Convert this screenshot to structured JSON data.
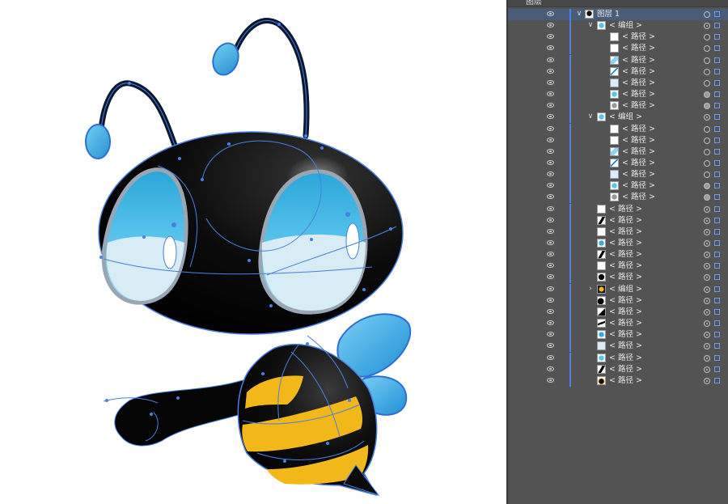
{
  "panel": {
    "tab_label": "图层",
    "rows": [
      {
        "label": "图层 1",
        "level": 0,
        "chev": "open",
        "thumb": "figure",
        "target": "ring"
      },
      {
        "label": "< 编组 >",
        "level": 1,
        "chev": "open",
        "thumb": "blue",
        "target": "double"
      },
      {
        "label": "< 路径 >",
        "level": 2,
        "thumb": "white",
        "target": "ring"
      },
      {
        "label": "< 路径 >",
        "level": 2,
        "thumb": "white",
        "target": "ring"
      },
      {
        "label": "< 路径 >",
        "level": 2,
        "thumb": "lightblue",
        "target": "ring"
      },
      {
        "label": "< 路径 >",
        "level": 2,
        "thumb": "stroke",
        "target": "ring"
      },
      {
        "label": "< 路径 >",
        "level": 2,
        "thumb": "pale",
        "target": "ring"
      },
      {
        "label": "< 路径 >",
        "level": 2,
        "thumb": "blue",
        "target": "filled"
      },
      {
        "label": "< 路径 >",
        "level": 2,
        "thumb": "grey",
        "target": "filled"
      },
      {
        "label": "< 编组 >",
        "level": 1,
        "chev": "open",
        "thumb": "blue",
        "target": "double"
      },
      {
        "label": "< 路径 >",
        "level": 2,
        "thumb": "white",
        "target": "ring"
      },
      {
        "label": "< 路径 >",
        "level": 2,
        "thumb": "white",
        "target": "ring"
      },
      {
        "label": "< 路径 >",
        "level": 2,
        "thumb": "lightblue",
        "target": "ring"
      },
      {
        "label": "< 路径 >",
        "level": 2,
        "thumb": "stroke",
        "target": "ring"
      },
      {
        "label": "< 路径 >",
        "level": 2,
        "thumb": "pale",
        "target": "ring"
      },
      {
        "label": "< 路径 >",
        "level": 2,
        "thumb": "blue",
        "target": "filled"
      },
      {
        "label": "< 路径 >",
        "level": 2,
        "thumb": "grey",
        "target": "filled"
      },
      {
        "label": "< 路径 >",
        "level": 1,
        "thumb": "white",
        "target": "double"
      },
      {
        "label": "< 路径 >",
        "level": 1,
        "thumb": "blackcurve",
        "target": "double"
      },
      {
        "label": "< 路径 >",
        "level": 1,
        "thumb": "white",
        "target": "double"
      },
      {
        "label": "< 路径 >",
        "level": 1,
        "thumb": "wing",
        "target": "double"
      },
      {
        "label": "< 路径 >",
        "level": 1,
        "thumb": "blackcurve",
        "target": "double"
      },
      {
        "label": "< 路径 >",
        "level": 1,
        "thumb": "white",
        "target": "double"
      },
      {
        "label": "< 路径 >",
        "level": 1,
        "thumb": "blackoval",
        "target": "double"
      },
      {
        "label": "< 编组 >",
        "level": 1,
        "chev": "closed",
        "thumb": "yellow",
        "target": "double"
      },
      {
        "label": "< 路径 >",
        "level": 1,
        "thumb": "blackblob",
        "target": "double"
      },
      {
        "label": "< 路径 >",
        "level": 1,
        "thumb": "blacktri",
        "target": "double"
      },
      {
        "label": "< 路径 >",
        "level": 1,
        "thumb": "stripe",
        "target": "double"
      },
      {
        "label": "< 路径 >",
        "level": 1,
        "thumb": "wing",
        "target": "double"
      },
      {
        "label": "< 路径 >",
        "level": 1,
        "thumb": "pale",
        "target": "double"
      },
      {
        "label": "< 路径 >",
        "level": 1,
        "thumb": "blue",
        "target": "double"
      },
      {
        "label": "< 路径 >",
        "level": 1,
        "thumb": "blackcurve",
        "target": "double"
      },
      {
        "label": "< 路径 >",
        "level": 1,
        "thumb": "body",
        "target": "double"
      }
    ]
  },
  "colors": {
    "selection": "#4b7fe0",
    "panel_bg": "#535353",
    "row_selected": "#4a5d78",
    "bee_yellow": "#f2b718",
    "eye_blue": "#3ab4e0"
  }
}
